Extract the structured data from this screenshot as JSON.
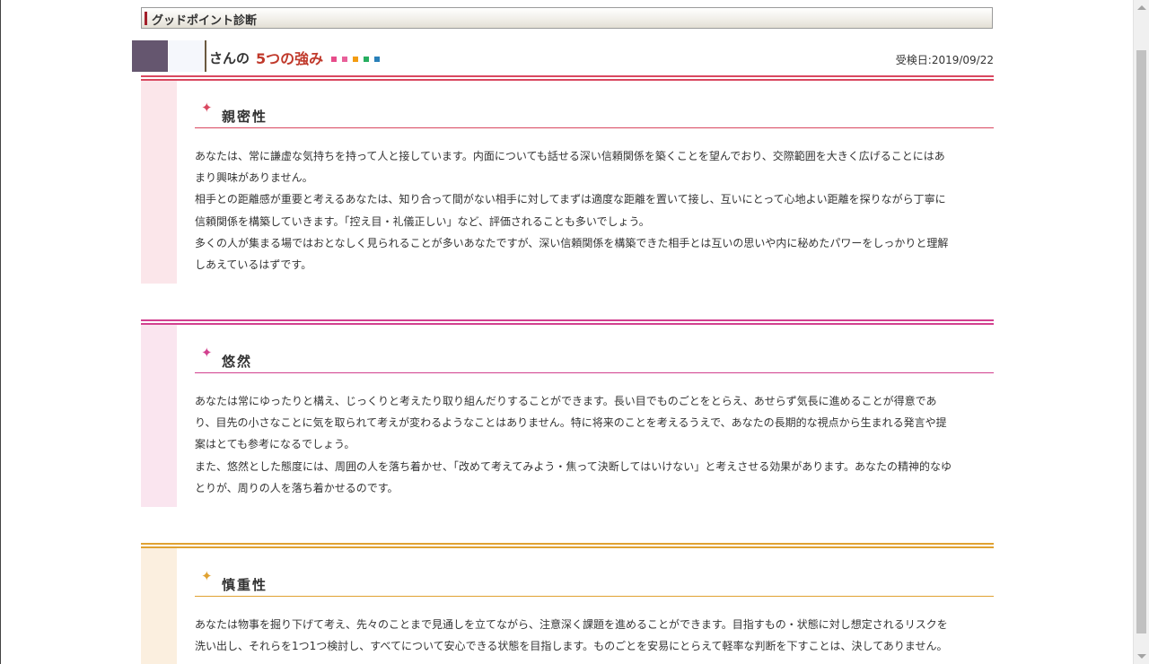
{
  "section": {
    "title": "グッドポイント診断"
  },
  "header": {
    "san": "さんの",
    "strengths_title": "5つの強み",
    "squares": [
      "#e74c8a",
      "#e8609a",
      "#f39c12",
      "#27ae60",
      "#2980b9"
    ],
    "test_date": "受検日:2019/09/22"
  },
  "strengths": [
    {
      "heading": "親密性",
      "icon": "sparkle-icon",
      "color": "#d94860",
      "side_color": "#fbe6ea",
      "paragraphs": [
        "あなたは、常に謙虚な気持ちを持って人と接しています。内面についても話せる深い信頼関係を築くことを望んでおり、交際範囲を大きく広げることにはあまり興味がありません。",
        "相手との距離感が重要と考えるあなたは、知り合って間がない相手に対してまずは適度な距離を置いて接し、互いにとって心地よい距離を探りながら丁寧に信頼関係を構築していきます。「控え目・礼儀正しい」など、評価されることも多いでしょう。",
        "多くの人が集まる場ではおとなしく見られることが多いあなたですが、深い信頼関係を構築できた相手とは互いの思いや内に秘めたパワーをしっかりと理解しあえているはずです。"
      ]
    },
    {
      "heading": "悠然",
      "icon": "sparkle-icon",
      "color": "#d2408f",
      "side_color": "#fae5ef",
      "paragraphs": [
        "あなたは常にゆったりと構え、じっくりと考えたり取り組んだりすることができます。長い目でものごとをとらえ、あせらず気長に進めることが得意であり、目先の小さなことに気を取られて考えが変わるようなことはありません。特に将来のことを考えるうえで、あなたの長期的な視点から生まれる発言や提案はとても参考になるでしょう。",
        "また、悠然とした態度には、周囲の人を落ち着かせ、「改めて考えてみよう・焦って決断してはいけない」と考えさせる効果があります。あなたの精神的なゆとりが、周りの人を落ち着かせるのです。"
      ]
    },
    {
      "heading": "慎重性",
      "icon": "sparkle-icon",
      "color": "#e0a232",
      "side_color": "#fbefdf",
      "paragraphs": [
        "あなたは物事を掘り下げて考え、先々のことまで見通しを立てながら、注意深く課題を進めることができます。目指すもの・状態に対し想定されるリスクを洗い出し、それらを1つ1つ検討し、すべてについて安心できる状態を目指します。ものごとを安易にとらえて軽率な判断を下すことは、決してありません。"
      ]
    }
  ]
}
